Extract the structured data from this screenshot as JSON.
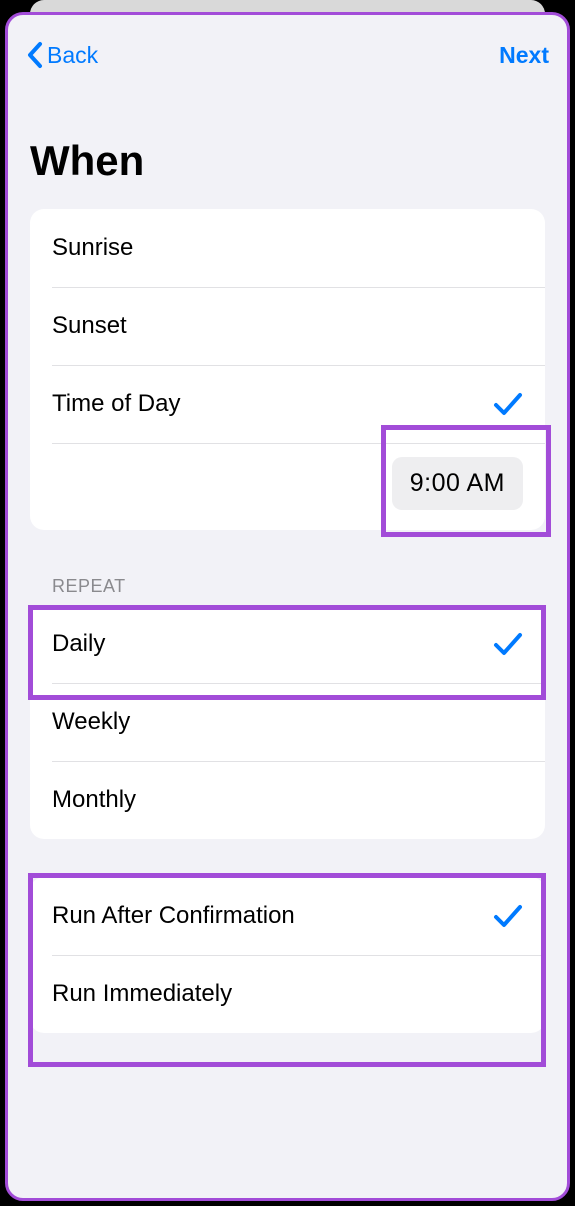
{
  "nav": {
    "back": "Back",
    "next": "Next"
  },
  "title": "When",
  "when": {
    "items": [
      {
        "label": "Sunrise",
        "checked": false
      },
      {
        "label": "Sunset",
        "checked": false
      },
      {
        "label": "Time of Day",
        "checked": true
      }
    ],
    "time": "9:00 AM"
  },
  "repeat": {
    "header": "REPEAT",
    "items": [
      {
        "label": "Daily",
        "checked": true
      },
      {
        "label": "Weekly",
        "checked": false
      },
      {
        "label": "Monthly",
        "checked": false
      }
    ]
  },
  "run": {
    "items": [
      {
        "label": "Run After Confirmation",
        "checked": true
      },
      {
        "label": "Run Immediately",
        "checked": false
      }
    ]
  }
}
